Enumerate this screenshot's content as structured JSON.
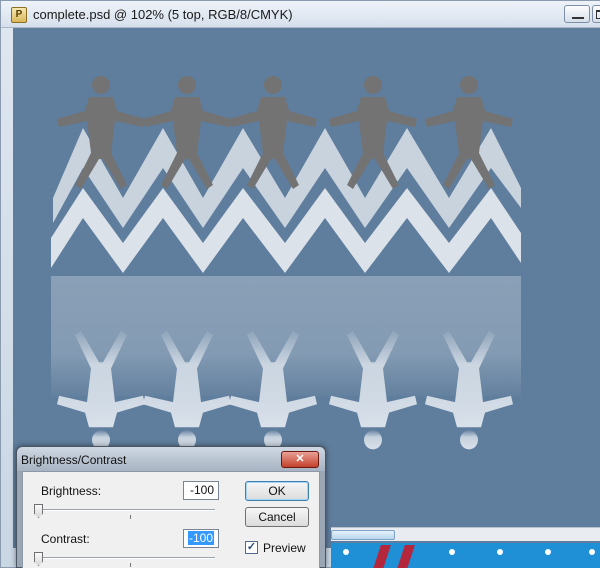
{
  "document": {
    "title": "complete.psd @ 102% (5 top, RGB/8/CMYK)",
    "icon": "photoshop-document-icon"
  },
  "window_controls": {
    "minimize_icon": "minimize-icon",
    "maximize_icon": "maximize-icon"
  },
  "canvas": {
    "background_color": "#5f7d9c",
    "figure_color": "#737373",
    "reflection_color": "#d4dde8"
  },
  "dialog": {
    "title": "Brightness/Contrast",
    "close_glyph": "✕",
    "brightness_label": "Brightness:",
    "brightness_value": "-100",
    "contrast_label": "Contrast:",
    "contrast_value": "-100",
    "ok_label": "OK",
    "cancel_label": "Cancel",
    "preview_label": "Preview",
    "preview_checked": true
  }
}
